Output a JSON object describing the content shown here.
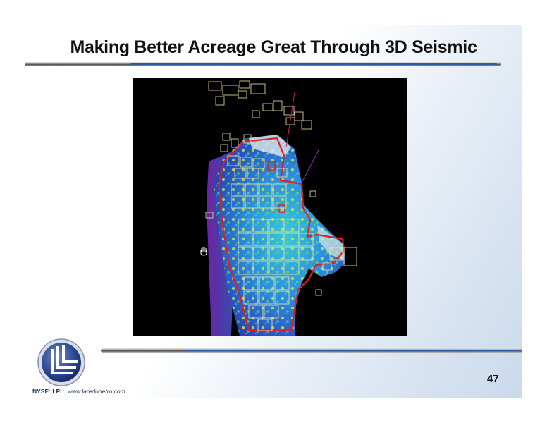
{
  "slide": {
    "title": "Making Better Acreage Great Through 3D Seismic",
    "page_number": "47",
    "ticker": "NYSE: LPI",
    "website": "www.laredopetro.com"
  },
  "colors": {
    "accent_blue": "#2a5aa8",
    "outline_red": "#e02020",
    "lease_yellow": "#f2e6a0"
  },
  "icons": {
    "logo": "laredo-lll-logo",
    "cursor": "hand-cursor-icon"
  }
}
